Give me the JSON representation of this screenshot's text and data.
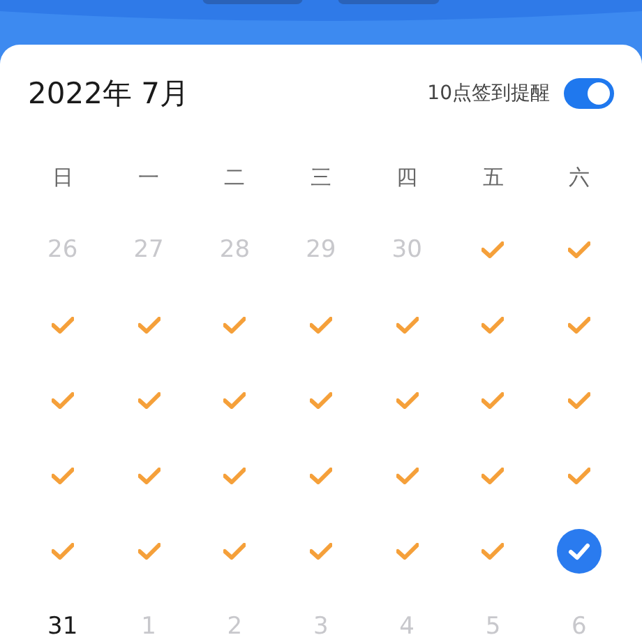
{
  "calendar": {
    "title": "2022年 7月",
    "reminder": {
      "label": "10点签到提醒",
      "on": true
    },
    "weekdays": [
      "日",
      "一",
      "二",
      "三",
      "四",
      "五",
      "六"
    ],
    "days": [
      {
        "kind": "number",
        "text": "26",
        "muted": true
      },
      {
        "kind": "number",
        "text": "27",
        "muted": true
      },
      {
        "kind": "number",
        "text": "28",
        "muted": true
      },
      {
        "kind": "number",
        "text": "29",
        "muted": true
      },
      {
        "kind": "number",
        "text": "30",
        "muted": true
      },
      {
        "kind": "check"
      },
      {
        "kind": "check"
      },
      {
        "kind": "check"
      },
      {
        "kind": "check"
      },
      {
        "kind": "check"
      },
      {
        "kind": "check"
      },
      {
        "kind": "check"
      },
      {
        "kind": "check"
      },
      {
        "kind": "check"
      },
      {
        "kind": "check"
      },
      {
        "kind": "check"
      },
      {
        "kind": "check"
      },
      {
        "kind": "check"
      },
      {
        "kind": "check"
      },
      {
        "kind": "check"
      },
      {
        "kind": "check"
      },
      {
        "kind": "check"
      },
      {
        "kind": "check"
      },
      {
        "kind": "check"
      },
      {
        "kind": "check"
      },
      {
        "kind": "check"
      },
      {
        "kind": "check"
      },
      {
        "kind": "check"
      },
      {
        "kind": "check"
      },
      {
        "kind": "check"
      },
      {
        "kind": "check"
      },
      {
        "kind": "check"
      },
      {
        "kind": "check"
      },
      {
        "kind": "check"
      },
      {
        "kind": "today"
      },
      {
        "kind": "number",
        "text": "31",
        "muted": false
      },
      {
        "kind": "number",
        "text": "1",
        "muted": true
      },
      {
        "kind": "number",
        "text": "2",
        "muted": true
      },
      {
        "kind": "number",
        "text": "3",
        "muted": true
      },
      {
        "kind": "number",
        "text": "4",
        "muted": true
      },
      {
        "kind": "number",
        "text": "5",
        "muted": true
      },
      {
        "kind": "number",
        "text": "6",
        "muted": true
      }
    ]
  }
}
